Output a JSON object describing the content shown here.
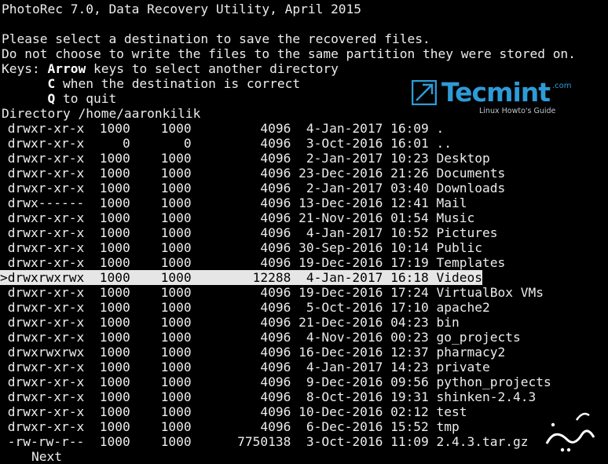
{
  "header": {
    "title": "PhotoRec 7.0, Data Recovery Utility, April 2015",
    "line1": "Please select a destination to save the recovered files.",
    "line2": "Do not choose to write the files to the same partition they were stored on.",
    "keys_prefix": "Keys: ",
    "key_arrow": "Arrow",
    "key_arrow_desc": " keys to select another directory",
    "key_c": "C",
    "key_c_desc": " when the destination is correct",
    "key_q": "Q",
    "key_q_desc": " to quit",
    "directory": "Directory /home/aaronkilik"
  },
  "entries": [
    {
      "perm": "drwxr-xr-x",
      "uid": "1000",
      "gid": "1000",
      "size": "4096",
      "date": "4-Jan-2017",
      "time": "16:09",
      "name": "."
    },
    {
      "perm": "drwxr-xr-x",
      "uid": "0",
      "gid": "0",
      "size": "4096",
      "date": "3-Oct-2016",
      "time": "16:01",
      "name": ".."
    },
    {
      "perm": "drwxr-xr-x",
      "uid": "1000",
      "gid": "1000",
      "size": "4096",
      "date": "2-Jan-2017",
      "time": "10:23",
      "name": "Desktop"
    },
    {
      "perm": "drwxr-xr-x",
      "uid": "1000",
      "gid": "1000",
      "size": "4096",
      "date": "23-Dec-2016",
      "time": "21:26",
      "name": "Documents"
    },
    {
      "perm": "drwxr-xr-x",
      "uid": "1000",
      "gid": "1000",
      "size": "4096",
      "date": "2-Jan-2017",
      "time": "03:40",
      "name": "Downloads"
    },
    {
      "perm": "drwx------",
      "uid": "1000",
      "gid": "1000",
      "size": "4096",
      "date": "13-Dec-2016",
      "time": "12:41",
      "name": "Mail"
    },
    {
      "perm": "drwxr-xr-x",
      "uid": "1000",
      "gid": "1000",
      "size": "4096",
      "date": "21-Nov-2016",
      "time": "01:54",
      "name": "Music"
    },
    {
      "perm": "drwxr-xr-x",
      "uid": "1000",
      "gid": "1000",
      "size": "4096",
      "date": "4-Jan-2017",
      "time": "10:52",
      "name": "Pictures"
    },
    {
      "perm": "drwxr-xr-x",
      "uid": "1000",
      "gid": "1000",
      "size": "4096",
      "date": "30-Sep-2016",
      "time": "10:14",
      "name": "Public"
    },
    {
      "perm": "drwxr-xr-x",
      "uid": "1000",
      "gid": "1000",
      "size": "4096",
      "date": "19-Dec-2016",
      "time": "17:19",
      "name": "Templates"
    },
    {
      "perm": "drwxrwxrwx",
      "uid": "1000",
      "gid": "1000",
      "size": "12288",
      "date": "4-Jan-2017",
      "time": "16:18",
      "name": "Videos",
      "selected": true
    },
    {
      "perm": "drwxr-xr-x",
      "uid": "1000",
      "gid": "1000",
      "size": "4096",
      "date": "19-Dec-2016",
      "time": "17:24",
      "name": "VirtualBox VMs"
    },
    {
      "perm": "drwxr-xr-x",
      "uid": "1000",
      "gid": "1000",
      "size": "4096",
      "date": "5-Oct-2016",
      "time": "17:10",
      "name": "apache2"
    },
    {
      "perm": "drwxr-xr-x",
      "uid": "1000",
      "gid": "1000",
      "size": "4096",
      "date": "21-Dec-2016",
      "time": "04:23",
      "name": "bin"
    },
    {
      "perm": "drwxr-xr-x",
      "uid": "1000",
      "gid": "1000",
      "size": "4096",
      "date": "4-Nov-2016",
      "time": "00:23",
      "name": "go_projects"
    },
    {
      "perm": "drwxrwxrwx",
      "uid": "1000",
      "gid": "1000",
      "size": "4096",
      "date": "16-Dec-2016",
      "time": "12:37",
      "name": "pharmacy2"
    },
    {
      "perm": "drwxr-xr-x",
      "uid": "1000",
      "gid": "1000",
      "size": "4096",
      "date": "4-Jan-2017",
      "time": "14:23",
      "name": "private"
    },
    {
      "perm": "drwxr-xr-x",
      "uid": "1000",
      "gid": "1000",
      "size": "4096",
      "date": "9-Dec-2016",
      "time": "09:56",
      "name": "python_projects"
    },
    {
      "perm": "drwxr-xr-x",
      "uid": "1000",
      "gid": "1000",
      "size": "4096",
      "date": "8-Oct-2016",
      "time": "19:31",
      "name": "shinken-2.4.3"
    },
    {
      "perm": "drwxr-xr-x",
      "uid": "1000",
      "gid": "1000",
      "size": "4096",
      "date": "10-Dec-2016",
      "time": "02:12",
      "name": "test"
    },
    {
      "perm": "drwxr-xr-x",
      "uid": "1000",
      "gid": "1000",
      "size": "4096",
      "date": "6-Dec-2016",
      "time": "15:52",
      "name": "tmp"
    },
    {
      "perm": "-rw-rw-r--",
      "uid": "1000",
      "gid": "1000",
      "size": "7750138",
      "date": "3-Oct-2016",
      "time": "11:09",
      "name": "2.4.3.tar.gz"
    }
  ],
  "selection_marker": ">",
  "footer": {
    "next": "Next"
  },
  "logo": {
    "brand": "Tecmint",
    "tld": ".com",
    "tagline": "Linux Howto's Guide",
    "icon": "tecmint-logo-icon"
  },
  "watermark": {
    "icon": "persian-watermark-icon"
  },
  "colors": {
    "background": "#000000",
    "text": "#ececec",
    "highlight": "#e6e6e6",
    "brand": "#2e9bd6"
  }
}
